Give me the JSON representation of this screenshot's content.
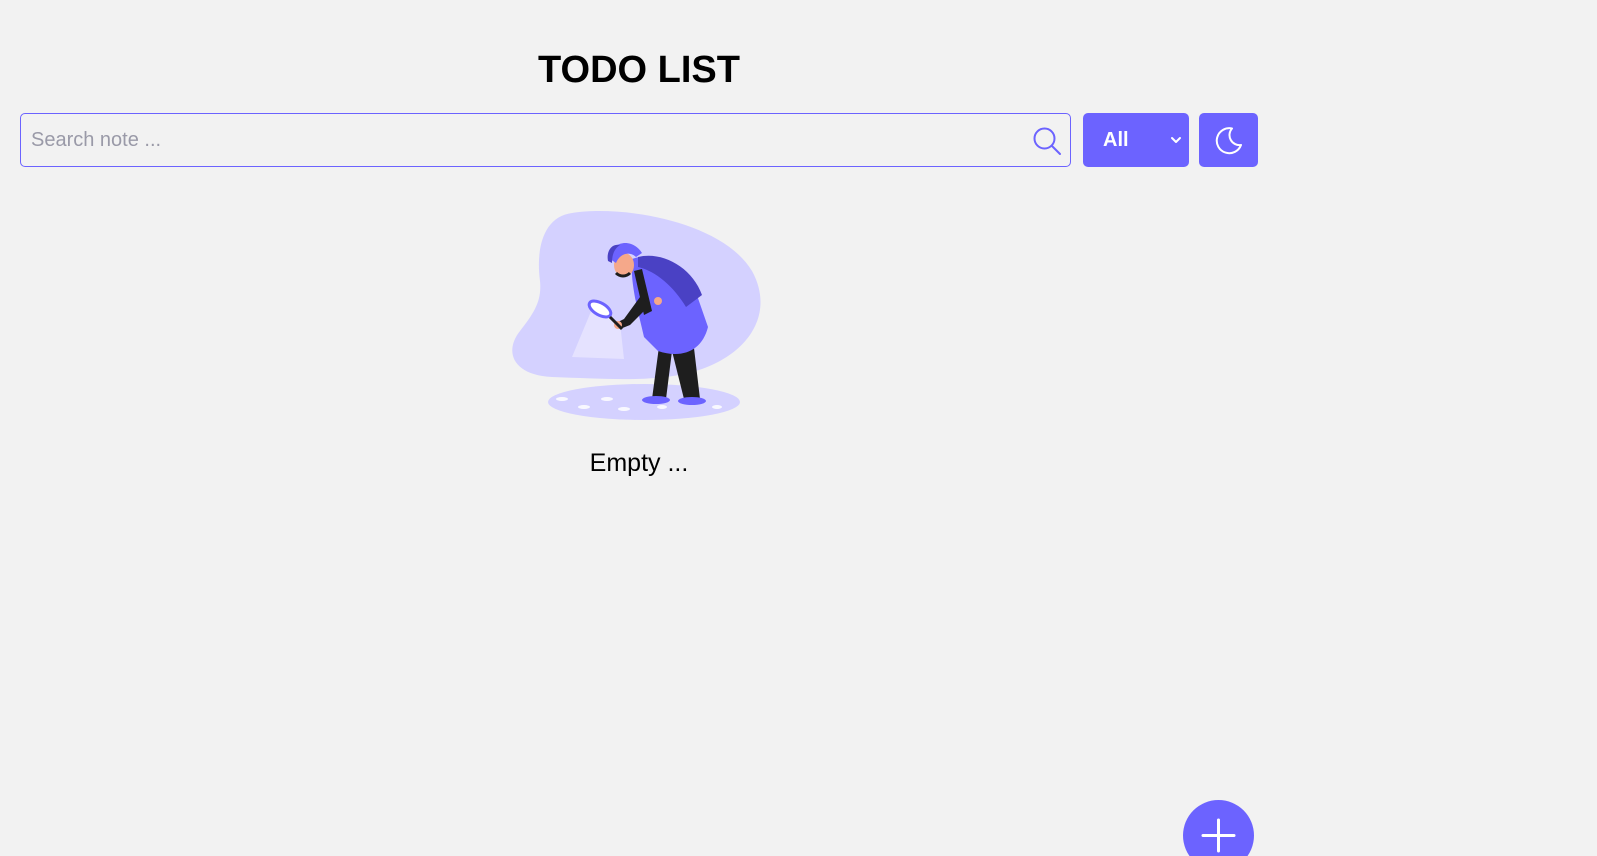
{
  "header": {
    "title": "TODO LIST"
  },
  "search": {
    "placeholder": "Search note ...",
    "value": "",
    "icon": "search-icon"
  },
  "filter": {
    "selected": "All",
    "icon": "chevron-down-icon"
  },
  "theme_toggle": {
    "icon": "moon-icon"
  },
  "empty_state": {
    "message": "Empty ...",
    "illustration": "detective-magnifying-glass-illustration"
  },
  "add_note": {
    "icon": "plus-icon"
  },
  "colors": {
    "accent": "#6c63ff",
    "accent_light": "#d4d1ff",
    "background": "#f2f2f2",
    "text": "#000000"
  }
}
